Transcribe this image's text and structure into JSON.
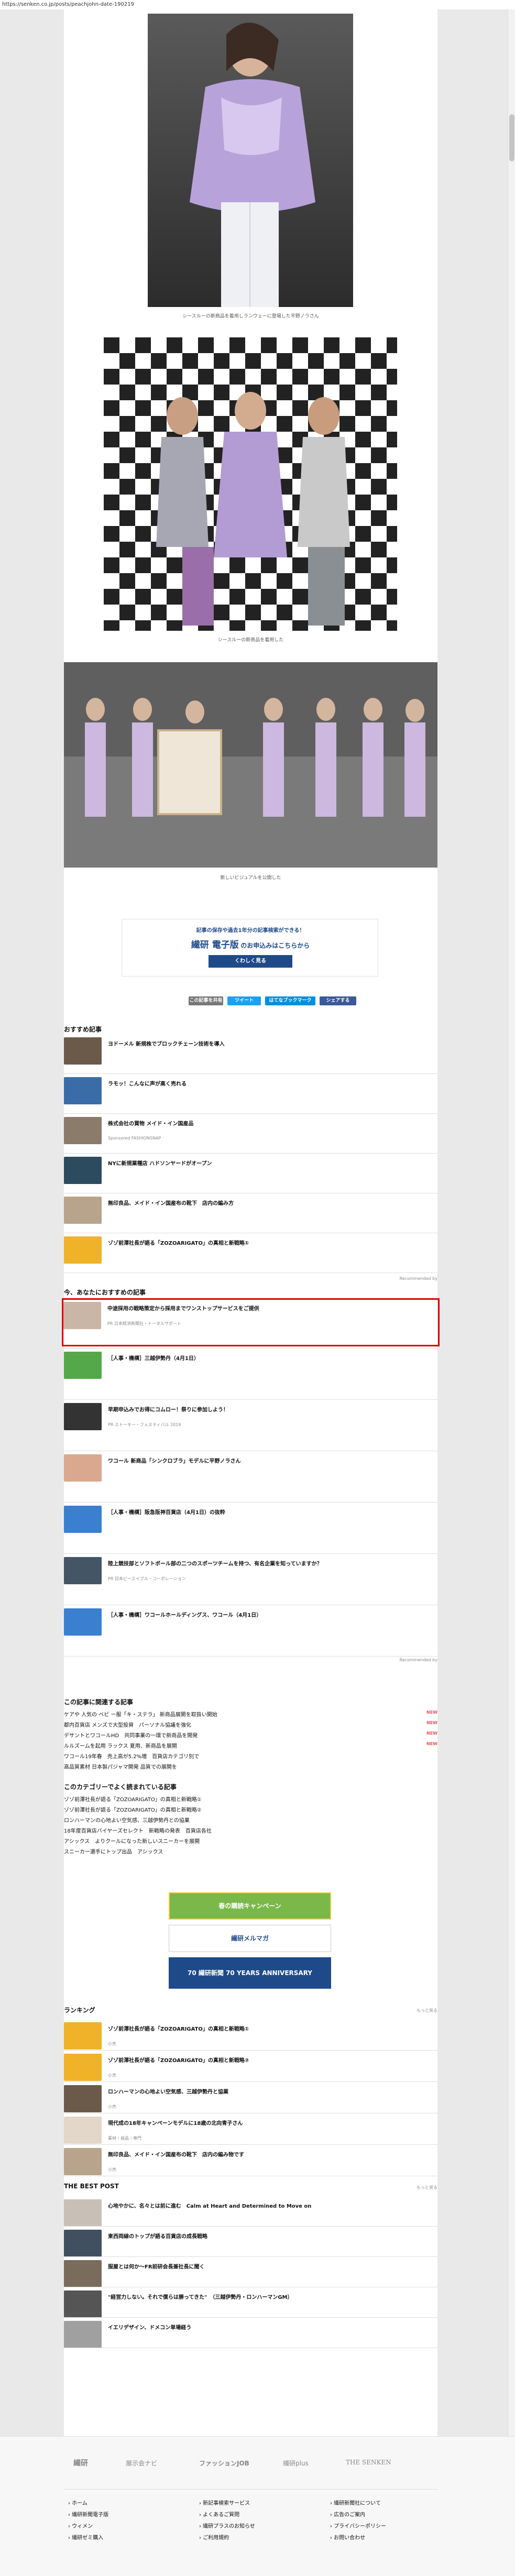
{
  "url": "https://senken.co.jp/posts/peachjohn-date-190219",
  "captions": {
    "c1": "シースルーの新商品を着用しランウェーに登場した平野ノラさん",
    "c2": "シースルーの新商品を着用した",
    "c3": "新しいビジュアルを公開した"
  },
  "ad": {
    "head": "記事の保存や過去1年分の記事検索ができる！",
    "brand": "繊研 電子版",
    "tail": "のお申込みはこちらから",
    "button": "くわしく見る"
  },
  "share": [
    "この記事を共有",
    "ツイート",
    "はてなブックマーク",
    "シェアする"
  ],
  "recommended": {
    "title": "おすすめ記事",
    "items": [
      {
        "text": "ヨドーメル 新規株でブロックチェーン技術を導入",
        "color": "#6b5a4a"
      },
      {
        "text": "ラモッ！こんなに声が高く売れる",
        "color": "#3a6ca8"
      },
      {
        "text": "株式会社の買物 メイド・イン国産品",
        "color": "#8a7b6b",
        "sub": "Sponsored FASHIONSNAP"
      },
      {
        "text": "NYに新規業種店 ハドソンヤードがオープン",
        "color": "#2d4b5f"
      },
      {
        "text": "無印良品、メイド・イン国産布の靴下　店内の編み方",
        "color": "#b8a48c"
      },
      {
        "text": "ゾゾ前澤社長が語る「ZOZOARIGATO」の真相と新戦略①",
        "color": "#f0b229"
      }
    ],
    "footer": "Recommended by"
  },
  "now": {
    "title": "今、あなたにおすすめの記事",
    "items": [
      {
        "text": "中途採用の戦略策定から採用までワンストップサービスをご提供",
        "sub": "PR 日本経済新聞社・トータルサポート",
        "color": "#c9b6a6"
      },
      {
        "text": "［人事・機構］三越伊勢丹（4月1日）",
        "sub": "",
        "color": "#55a84a"
      },
      {
        "text": "早期申込みでお得にコムロー！祭りに参加しよう！",
        "sub": "PR ストーキー・フェスティバル 2019",
        "color": "#333"
      },
      {
        "text": "ワコール 新商品「シンクロブラ」モデルに平野ノラさん",
        "sub": "",
        "color": "#d9a88f"
      },
      {
        "text": "［人事・機構］阪急阪神百貨店（4月1日）の抜粋",
        "sub": "",
        "color": "#3b7fd1"
      },
      {
        "text": "陸上競技部とソフトボール部の二つのスポーツチームを持つ、有名企業を知っていますか？",
        "sub": "PR 日本ピーエイブル・コーポレーション",
        "color": "#456"
      },
      {
        "text": "［人事・機構］ワコールホールディングス、ワコール（4月1日）",
        "sub": "",
        "color": "#3b7fd1"
      }
    ],
    "footer": "Recommended by"
  },
  "related": {
    "title": "この記事に関連する記事",
    "items": [
      {
        "text": "ケアや 人気の ベビ ー服「キ・ステラ」 新商品展開を取扱い開始",
        "badge": "NEW"
      },
      {
        "text": "都内百貨店 メンズで大型投資　パーソナル協議を強化",
        "badge": "NEW"
      },
      {
        "text": "デサントとワコールHD　共同事業の一環で新商品を開発",
        "badge": "NEW"
      },
      {
        "text": "ルルズームを起用 ラックス 夏用、新商品を展開",
        "badge": "NEW"
      },
      {
        "text": "ワコール19年春　売上高が5.2%増　百貨店カテゴリ別で",
        "badge": ""
      },
      {
        "text": "高品質素材 日本製パジャマ開発 品質での展開を",
        "badge": ""
      }
    ]
  },
  "popular": {
    "title": "このカテゴリーでよく読まれている記事",
    "items": [
      "ゾゾ前澤社長が語る「ZOZOARIGATO」の真相と新戦略①",
      "ゾゾ前澤社長が語る「ZOZOARIGATO」の真相と新戦略②",
      "ロンハーマンの心地よい空気感、三越伊勢丹との協業",
      "18年度百貨店バイヤーズセレクト　新戦略の発表　百貨店各社",
      "アシックス　よりクールになった新しいスニーカーを展開",
      "スニーカー選手にトップ出品　アシックス"
    ]
  },
  "banners": [
    "春の購読キャンペーン",
    "繊研メルマガ",
    "70 繊研新聞 70 YEARS ANNIVERSARY"
  ],
  "ranking": {
    "title": "ランキング",
    "more": "もっと見る",
    "items": [
      {
        "text": "ゾゾ前澤社長が語る「ZOZOARIGATO」の真相と新戦略①",
        "sub": "小売",
        "color": "#f0b229"
      },
      {
        "text": "ゾゾ前澤社長が語る「ZOZOARIGATO」の真相と新戦略②",
        "sub": "小売",
        "color": "#f0b229"
      },
      {
        "text": "ロンハーマンの心地よい空気感、三越伊勢丹と協業",
        "sub": "小売",
        "color": "#6b5a4a"
      },
      {
        "text": "現代成の18年キャンペーンモデルに18歳の北向青子さん",
        "sub": "素材・商品・専門",
        "color": "#e3d7c9"
      },
      {
        "text": "無印良品、メイド・イン国産布の靴下　店内の編み物です",
        "sub": "小売",
        "color": "#b8a48c"
      }
    ]
  },
  "best": {
    "title": "THE BEST POST",
    "more": "もっと見る",
    "items": [
      {
        "text": "心地やかに、名々とは前に進む　Calm at Heart and Determined to Move on",
        "sub": "",
        "color": "#c8c0b6"
      },
      {
        "text": "東西両線のトップが語る百貨店の成長戦略",
        "sub": "",
        "color": "#405060"
      },
      {
        "text": "服屋とは何か～FR前研会長兼社長に聞く",
        "sub": "",
        "color": "#7a6c5d"
      },
      {
        "text": "\"経営力しない。それで僕らは勝ってきた\"　（三越伊勢丹・ロンハーマンGM）",
        "sub": "",
        "color": "#555"
      },
      {
        "text": "イエリデザイン、ドメコン単場経う",
        "sub": "",
        "color": "#a0a0a0"
      }
    ]
  },
  "footer": {
    "logos": [
      "繊研",
      "展示会ナビ",
      "ファッションJOB",
      "繊研plus",
      "THE SENKEN"
    ],
    "col1": [
      "ホーム",
      "繊研新聞電子版",
      "ウィメン",
      "繊研ゼミ購入"
    ],
    "col2": [
      "新記事検索サービス",
      "よくあるご質問",
      "繊研プラスのお知らせ",
      "ご利用規約"
    ],
    "col3": [
      "繊研新聞社について",
      "広告のご案内",
      "プライバシーポリシー",
      "お問い合わせ"
    ]
  },
  "colors": {
    "accent": "#1e4a8a",
    "highlight": "#e00000",
    "twitter": "#1da1f2",
    "hatena": "#008fde",
    "facebook": "#3b5998",
    "new": "#e05555"
  }
}
